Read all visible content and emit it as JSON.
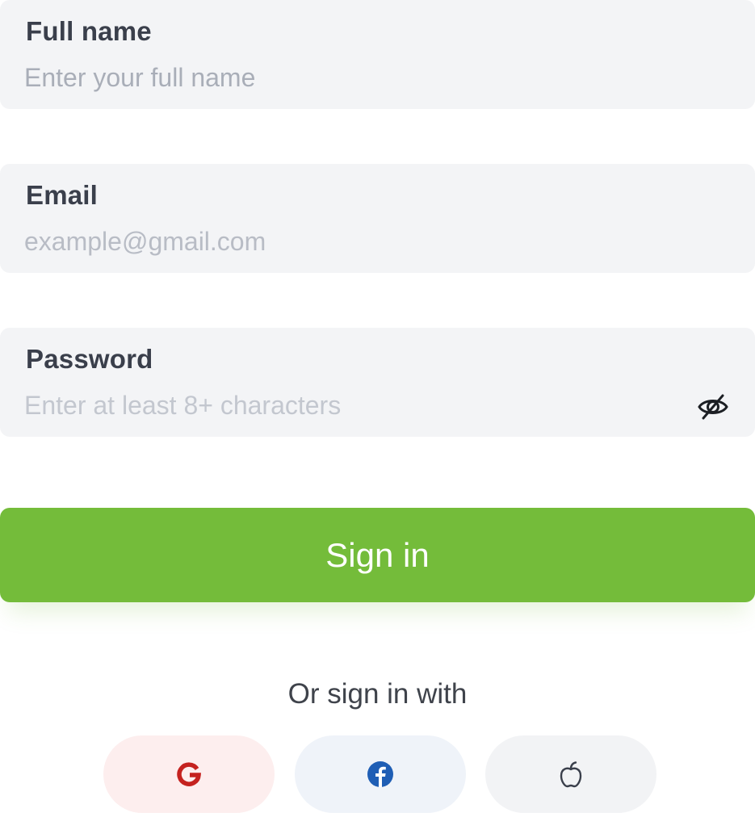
{
  "form": {
    "full_name": {
      "label": "Full name",
      "placeholder": "Enter your full name",
      "value": ""
    },
    "email": {
      "label": "Email",
      "placeholder": "example@gmail.com",
      "value": ""
    },
    "password": {
      "label": "Password",
      "placeholder": "Enter at least 8+ characters",
      "value": "",
      "visibility_icon": "eye-off-icon"
    }
  },
  "submit": {
    "label": "Sign in"
  },
  "social": {
    "caption": "Or sign in with",
    "providers": [
      {
        "name": "Google",
        "icon": "google-icon",
        "color": "#c5221f",
        "background": "#fdeeee"
      },
      {
        "name": "Facebook",
        "icon": "facebook-icon",
        "color": "#1f5eb5",
        "background": "#eff3f9"
      },
      {
        "name": "Apple",
        "icon": "apple-icon",
        "color": "#3a3f4b",
        "background": "#f2f3f5"
      }
    ]
  },
  "colors": {
    "accent": "#74bc3a",
    "field_background": "#f3f4f6",
    "label_text": "#3a3f4b",
    "placeholder_text": "#a9aeb8"
  }
}
